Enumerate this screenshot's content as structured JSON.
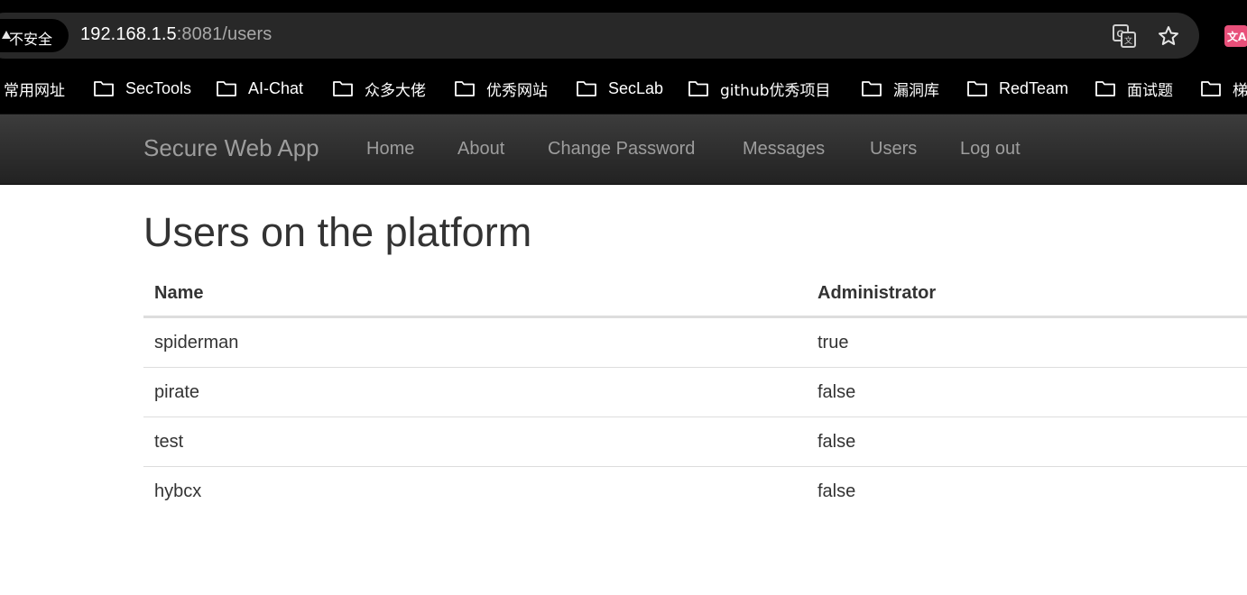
{
  "browser": {
    "security_label": "不安全",
    "url_host": "192.168.1.5",
    "url_rest": ":8081/users",
    "bookmarks": [
      "常用网址",
      "SecTools",
      "AI-Chat",
      "众多大佬",
      "优秀网站",
      "SecLab",
      "github优秀项目",
      "漏洞库",
      "RedTeam",
      "面试题",
      "梯"
    ]
  },
  "navbar": {
    "brand": "Secure Web App",
    "links": [
      "Home",
      "About",
      "Change Password",
      "Messages",
      "Users",
      "Log out"
    ]
  },
  "main": {
    "title": "Users on the platform",
    "table": {
      "headers": [
        "Name",
        "Administrator"
      ],
      "rows": [
        [
          "spiderman",
          "true"
        ],
        [
          "pirate",
          "false"
        ],
        [
          "test",
          "false"
        ],
        [
          "hybcx",
          "false"
        ]
      ]
    }
  },
  "colors": {
    "chrome_bg": "#000000",
    "omnibox_bg": "#282828",
    "navbar_text": "#9d9d9d",
    "body_text": "#333333",
    "extension_accent": "#e8507a"
  }
}
